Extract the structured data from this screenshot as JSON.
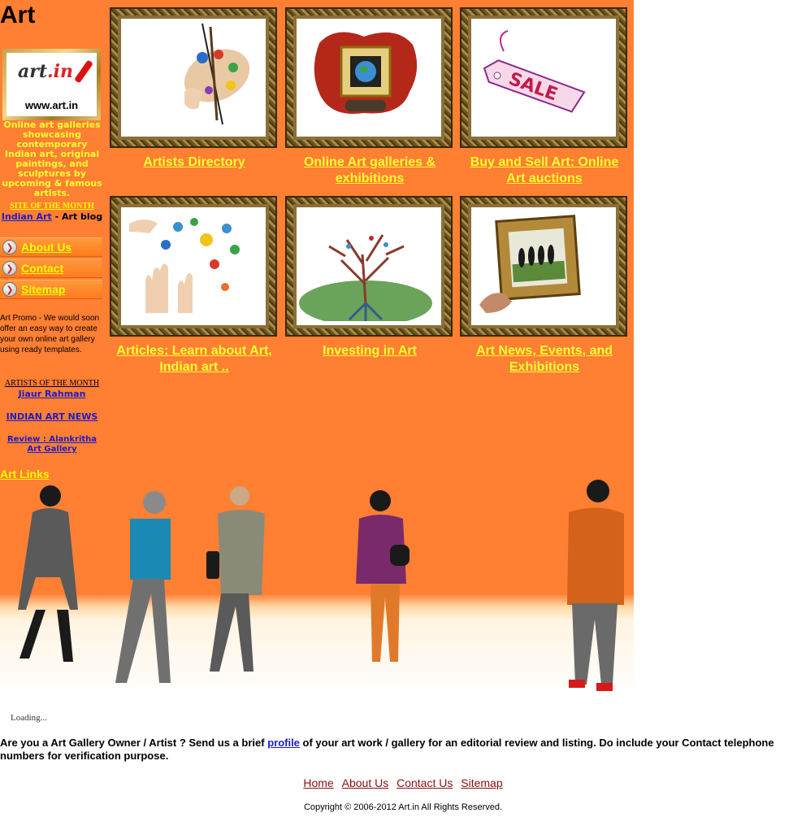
{
  "site": {
    "title": "Art"
  },
  "logo": {
    "text": "artin",
    "url": "www.art.in"
  },
  "sidebar": {
    "description": "Online art galleries showcasing contemporary Indian art, original paintings, and sculptures by upcoming & famous artists.",
    "site_of_month_title": "SITE OF THE MONTH",
    "site_of_month_link": "Indian Art",
    "site_of_month_suffix": " - Art blog",
    "nav": [
      {
        "label": "About Us"
      },
      {
        "label": "Contact"
      },
      {
        "label": "Sitemap"
      }
    ],
    "promo": "Art Promo - We would soon offer an easy way to create your own online art gallery using ready templates.",
    "artists_of_month_title": "ARTISTS OF THE MONTH",
    "artists_of_month_name": "Jiaur Rahman",
    "indian_art_news": "INDIAN ART NEWS",
    "review_link": "Review : Alankritha Art Gallery",
    "art_links": "Art Links"
  },
  "tiles": [
    {
      "label": "Artists Directory",
      "icon": "palette-icon"
    },
    {
      "label": "Online Art galleries & exhibitions",
      "icon": "gallery-frame-icon"
    },
    {
      "label": "Buy and Sell Art: Online Art auctions",
      "icon": "sale-tag-icon"
    },
    {
      "label": "Articles: Learn about Art, Indian art ..",
      "icon": "paint-hands-icon"
    },
    {
      "label": "Investing in Art",
      "icon": "tree-icon"
    },
    {
      "label": "Art News, Events, and Exhibitions",
      "icon": "framed-painting-icon"
    }
  ],
  "loading_text": "Loading...",
  "owner_message": {
    "before": "Are you a Art Gallery Owner / Artist ? Send us a brief ",
    "link": "profile",
    "after": " of your art work / gallery for an editorial review and listing. Do include your Contact telephone numbers for verification purpose."
  },
  "footer": {
    "links": [
      "Home",
      "About Us",
      "Contact Us",
      "Sitemap"
    ],
    "copyright": "Copyright © 2006-2012 Art.in  All Rights Reserved."
  }
}
